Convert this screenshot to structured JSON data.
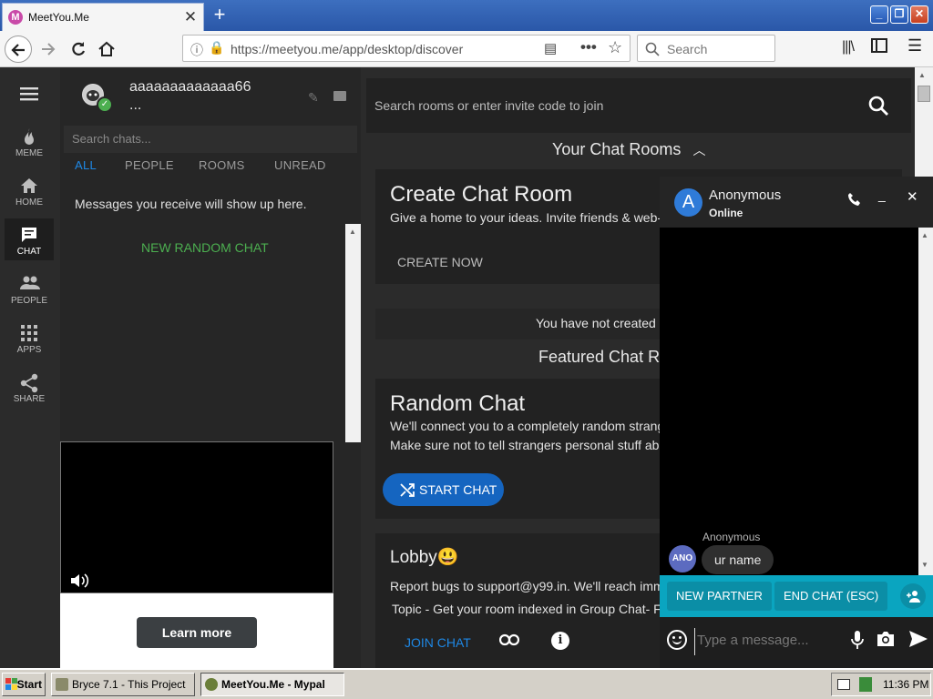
{
  "colors": {
    "accent": "#1565c0",
    "success": "#4caf50",
    "chat_bar": "#0aa5c0",
    "taskbar": "#d4d0c8"
  },
  "browser": {
    "tab_title": "MeetYou.Me",
    "tab_favicon": "M",
    "url": "https://meetyou.me/app/desktop/discover",
    "search_placeholder": "Search"
  },
  "rail": {
    "items": [
      {
        "label": "MEME",
        "icon": "flame-icon"
      },
      {
        "label": "HOME",
        "icon": "home-icon"
      },
      {
        "label": "CHAT",
        "icon": "chat-icon"
      },
      {
        "label": "PEOPLE",
        "icon": "people-icon"
      },
      {
        "label": "APPS",
        "icon": "apps-icon"
      },
      {
        "label": "SHARE",
        "icon": "share-icon"
      }
    ]
  },
  "profile": {
    "username": "aaaaaaaaaaaaa66",
    "status": "..."
  },
  "chats": {
    "search_placeholder": "Search chats...",
    "filters": [
      "ALL",
      "PEOPLE",
      "ROOMS",
      "UNREAD"
    ],
    "empty_message": "Messages you receive will show up here.",
    "new_random": "NEW RANDOM CHAT"
  },
  "ad": {
    "learn_more": "Learn more"
  },
  "main": {
    "room_search_placeholder": "Search rooms or enter invite code to join",
    "your_rooms": "Your Chat Rooms",
    "create": {
      "title": "Create Chat Room",
      "text": "Give a home to your ideas. Invite friends & web-",
      "button": "CREATE NOW"
    },
    "not_created": "You have not created a",
    "featured": "Featured Chat Ro",
    "random": {
      "title": "Random Chat",
      "line1": "We'll connect you to a completely random strang",
      "line2": "Make sure not to tell strangers personal stuff abo",
      "button": "START CHAT"
    },
    "lobby": {
      "title": "Lobby",
      "emoji": "😃",
      "line1": "Report bugs to support@y99.in. We'll reach imm",
      "line2": "Topic - Get your room indexed in Group Chat- F",
      "button": "JOIN CHAT"
    }
  },
  "float_chat": {
    "avatar_letter": "A",
    "name": "Anonymous",
    "status": "Online",
    "message_sender": "Anonymous",
    "message_avatar": "ANO",
    "message_text": "ur name",
    "new_partner": "NEW PARTNER",
    "end_chat": "END CHAT (ESC)",
    "input_placeholder": "Type a message..."
  },
  "taskbar": {
    "start": "Start",
    "tasks": [
      "Bryce 7.1 - This Project",
      "MeetYou.Me - Mypal"
    ],
    "clock": "11:36 PM"
  }
}
